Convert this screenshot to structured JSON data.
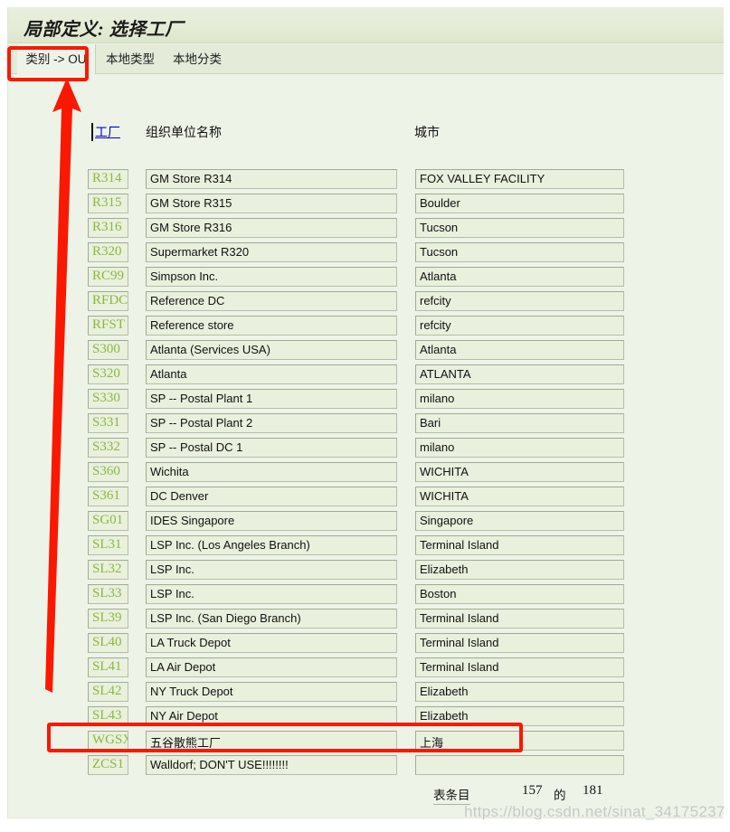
{
  "window": {
    "title": "局部定义: 选择工厂"
  },
  "tabs": [
    {
      "label": "类别  -> OU",
      "active": true,
      "name": "tab-category-to-ou"
    },
    {
      "label": "本地类型",
      "active": false,
      "name": "tab-local-type"
    },
    {
      "label": "本地分类",
      "active": false,
      "name": "tab-local-category"
    }
  ],
  "table": {
    "headers": {
      "plant": "工厂",
      "org_unit_name": "组织单位名称",
      "city": "城市"
    },
    "rows": [
      {
        "plant": "R314",
        "org_unit_name": "GM Store R314",
        "city": "FOX VALLEY FACILITY"
      },
      {
        "plant": "R315",
        "org_unit_name": "GM Store R315",
        "city": "Boulder"
      },
      {
        "plant": "R316",
        "org_unit_name": "GM Store R316",
        "city": "Tucson"
      },
      {
        "plant": "R320",
        "org_unit_name": "Supermarket R320",
        "city": "Tucson"
      },
      {
        "plant": "RC99",
        "org_unit_name": "Simpson Inc.",
        "city": "Atlanta"
      },
      {
        "plant": "RFDC",
        "org_unit_name": "Reference DC",
        "city": "refcity"
      },
      {
        "plant": "RFST",
        "org_unit_name": "Reference store",
        "city": "refcity"
      },
      {
        "plant": "S300",
        "org_unit_name": "Atlanta (Services USA)",
        "city": "Atlanta"
      },
      {
        "plant": "S320",
        "org_unit_name": "Atlanta",
        "city": "ATLANTA"
      },
      {
        "plant": "S330",
        "org_unit_name": "SP -- Postal Plant 1",
        "city": "milano"
      },
      {
        "plant": "S331",
        "org_unit_name": "SP -- Postal Plant 2",
        "city": "Bari"
      },
      {
        "plant": "S332",
        "org_unit_name": "SP -- Postal DC 1",
        "city": "milano"
      },
      {
        "plant": "S360",
        "org_unit_name": "Wichita",
        "city": "WICHITA"
      },
      {
        "plant": "S361",
        "org_unit_name": "DC Denver",
        "city": "WICHITA"
      },
      {
        "plant": "SG01",
        "org_unit_name": "IDES Singapore",
        "city": "Singapore"
      },
      {
        "plant": "SL31",
        "org_unit_name": "LSP Inc. (Los Angeles Branch)",
        "city": "Terminal Island"
      },
      {
        "plant": "SL32",
        "org_unit_name": "LSP Inc.",
        "city": "Elizabeth"
      },
      {
        "plant": "SL33",
        "org_unit_name": "LSP Inc.",
        "city": "Boston"
      },
      {
        "plant": "SL39",
        "org_unit_name": "LSP Inc. (San Diego Branch)",
        "city": "Terminal Island"
      },
      {
        "plant": "SL40",
        "org_unit_name": "LA Truck Depot",
        "city": "Terminal Island"
      },
      {
        "plant": "SL41",
        "org_unit_name": "LA Air Depot",
        "city": "Terminal Island"
      },
      {
        "plant": "SL42",
        "org_unit_name": "NY Truck Depot",
        "city": "Elizabeth"
      },
      {
        "plant": "SL43",
        "org_unit_name": "NY Air Depot",
        "city": "Elizabeth"
      },
      {
        "plant": "WGSX",
        "org_unit_name": "五谷散熊工厂",
        "city": "上海"
      },
      {
        "plant": "ZCS1",
        "org_unit_name": "Walldorf; DON'T USE!!!!!!!!",
        "city": ""
      }
    ]
  },
  "footer": {
    "label": "表条目",
    "current": "157",
    "of": "的",
    "total": "181"
  },
  "watermark": {
    "text": "https://blog.csdn.net/sinat_34175237"
  },
  "colors": {
    "panel_bg": "#eef3e8",
    "cell_bg": "#e9f0dd",
    "plant_code": "#8cb83c",
    "annotation": "#fb1800",
    "link": "#0000d0"
  }
}
